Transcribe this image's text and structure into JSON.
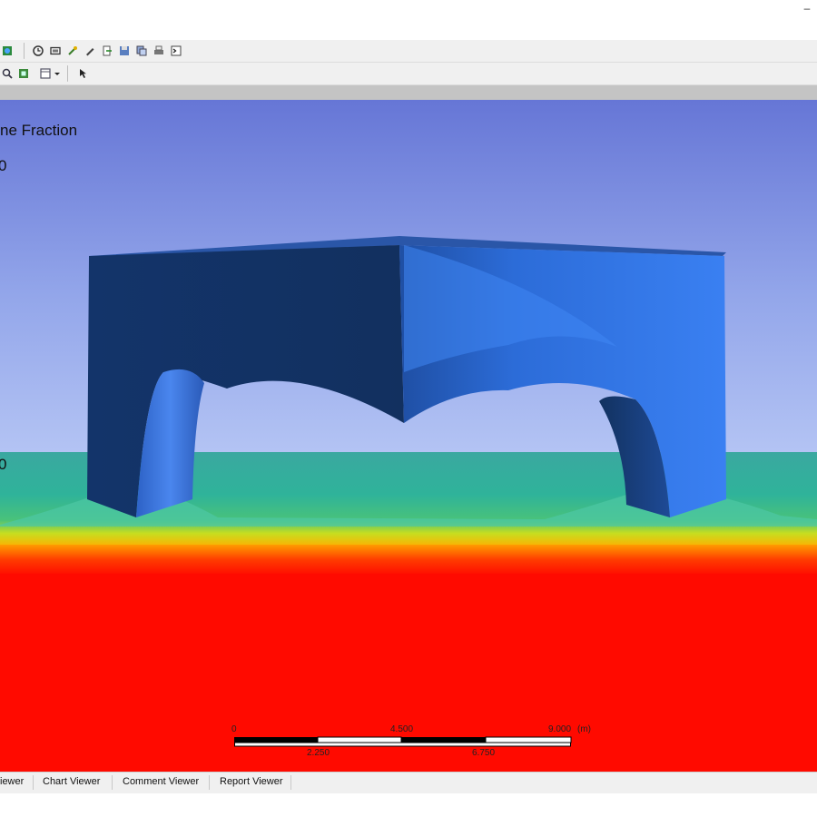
{
  "window": {
    "minimize_glyph": "–"
  },
  "toolbar_row1": {
    "icons": [
      "view-icon",
      "clock-icon",
      "frame-icon",
      "probe-icon",
      "pen-icon",
      "export-icon",
      "save-icon",
      "copy-icon",
      "print-icon",
      "terminal-icon"
    ]
  },
  "toolbar_row2": {
    "icons": [
      "zoom-icon",
      "fit-icon",
      "viewport-layout-icon",
      "dropdown-arrow-icon",
      "pointer-icon"
    ]
  },
  "viewport": {
    "legend": {
      "title": "ne Fraction",
      "ticks": [
        "0",
        "0"
      ]
    },
    "scale_bar": {
      "top_labels": [
        "0",
        "4.500",
        "9.000"
      ],
      "unit": "(m)",
      "bottom_labels": [
        "2.250",
        "6.750"
      ]
    },
    "colors": {
      "sky_top": "#6878d8",
      "sky_bottom": "#a8b8f0",
      "water": "#ff0a00",
      "interface": "#3fbf9f",
      "hull_dark": "#14346a",
      "hull_light": "#3a7cf0"
    }
  },
  "tabs": [
    "iewer",
    "Chart Viewer",
    "Comment Viewer",
    "Report Viewer"
  ]
}
